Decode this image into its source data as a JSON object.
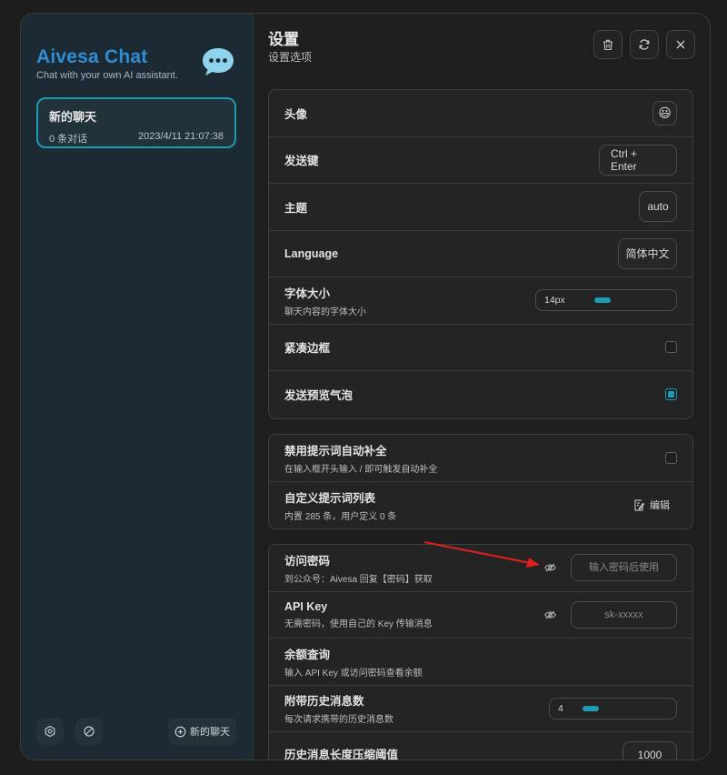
{
  "sidebar": {
    "brand_title": "Aivesa Chat",
    "brand_subtitle": "Chat with your own AI assistant.",
    "chats": [
      {
        "title": "新的聊天",
        "count": "0 条对话",
        "time": "2023/4/11 21:07:38"
      }
    ],
    "new_chat_label": "新的聊天"
  },
  "header": {
    "title": "设置",
    "subtitle": "设置选项"
  },
  "settings": {
    "avatar": {
      "label": "头像",
      "value": "😃"
    },
    "send_key": {
      "label": "发送键",
      "value": "Ctrl + Enter"
    },
    "theme": {
      "label": "主题",
      "value": "auto"
    },
    "language": {
      "label": "Language",
      "value": "简体中文"
    },
    "font_size": {
      "label": "字体大小",
      "sub": "聊天内容的字体大小",
      "value": "14px",
      "level": 0.45
    },
    "compact": {
      "label": "紧凑边框",
      "checked": false
    },
    "preview": {
      "label": "发送预览气泡",
      "checked": true
    },
    "disable_prompt": {
      "label": "禁用提示词自动补全",
      "sub": "在输入框开头输入 / 即可触发自动补全",
      "checked": false
    },
    "custom_prompt": {
      "label": "自定义提示词列表",
      "sub": "内置 285 条，用户定义 0 条",
      "edit_label": "编辑"
    },
    "access_code": {
      "label": "访问密码",
      "sub": "到公众号：Aivesa 回复【密码】获取",
      "placeholder": "输入密码后使用"
    },
    "api_key": {
      "label": "API Key",
      "sub": "无需密码，使用自己的 Key 传输消息",
      "placeholder": "sk-xxxxx"
    },
    "balance": {
      "label": "余额查询",
      "sub": "输入 API Key 或访问密码查看余额"
    },
    "history_count": {
      "label": "附带历史消息数",
      "sub": "每次请求携带的历史消息数",
      "value": "4",
      "level": 0.1
    },
    "compress_threshold": {
      "label": "历史消息长度压缩阈值",
      "value": "1000"
    }
  },
  "colors": {
    "accent": "#1d9bb5",
    "brand": "#2f8dd4",
    "sidebar_bg": "#1b2a33",
    "annotation_arrow": "#e0201c"
  }
}
